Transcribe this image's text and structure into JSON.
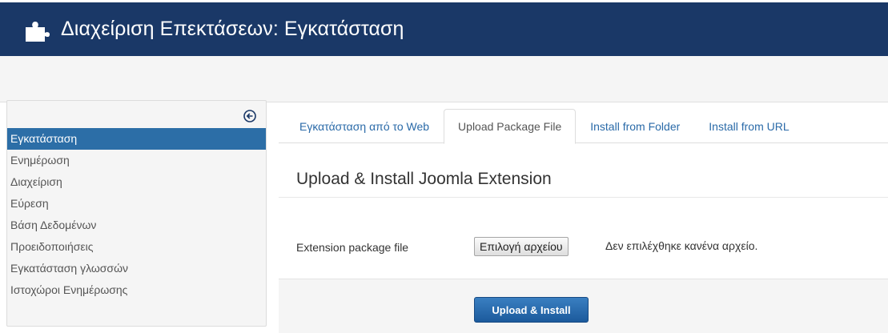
{
  "header": {
    "title": "Διαχείριση Επεκτάσεων: Εγκατάσταση",
    "icon": "puzzle-icon"
  },
  "sidebar": {
    "collapse_icon": "collapse-left-icon",
    "active_color": "#2c6ea7",
    "items": [
      {
        "label": "Εγκατάσταση",
        "active": true
      },
      {
        "label": "Ενημέρωση",
        "active": false
      },
      {
        "label": "Διαχείριση",
        "active": false
      },
      {
        "label": "Εύρεση",
        "active": false
      },
      {
        "label": "Βάση Δεδομένων",
        "active": false
      },
      {
        "label": "Προειδοποιήσεις",
        "active": false
      },
      {
        "label": "Εγκατάσταση γλωσσών",
        "active": false
      },
      {
        "label": "Ιστοχώροι Ενημέρωσης",
        "active": false
      }
    ]
  },
  "tabs": [
    {
      "label": "Εγκατάσταση από το Web",
      "active": false
    },
    {
      "label": "Upload Package File",
      "active": true
    },
    {
      "label": "Install from Folder",
      "active": false
    },
    {
      "label": "Install from URL",
      "active": false
    }
  ],
  "main": {
    "heading": "Upload & Install Joomla Extension",
    "field_label": "Extension package file",
    "file_button": "Επιλογή αρχείου",
    "file_status": "Δεν επιλέχθηκε κανένα αρχείο.",
    "install_button": "Upload & Install"
  },
  "colors": {
    "header_bg": "#1a3867",
    "link": "#2a6aa8",
    "primary_button": "#2a6cb0"
  }
}
